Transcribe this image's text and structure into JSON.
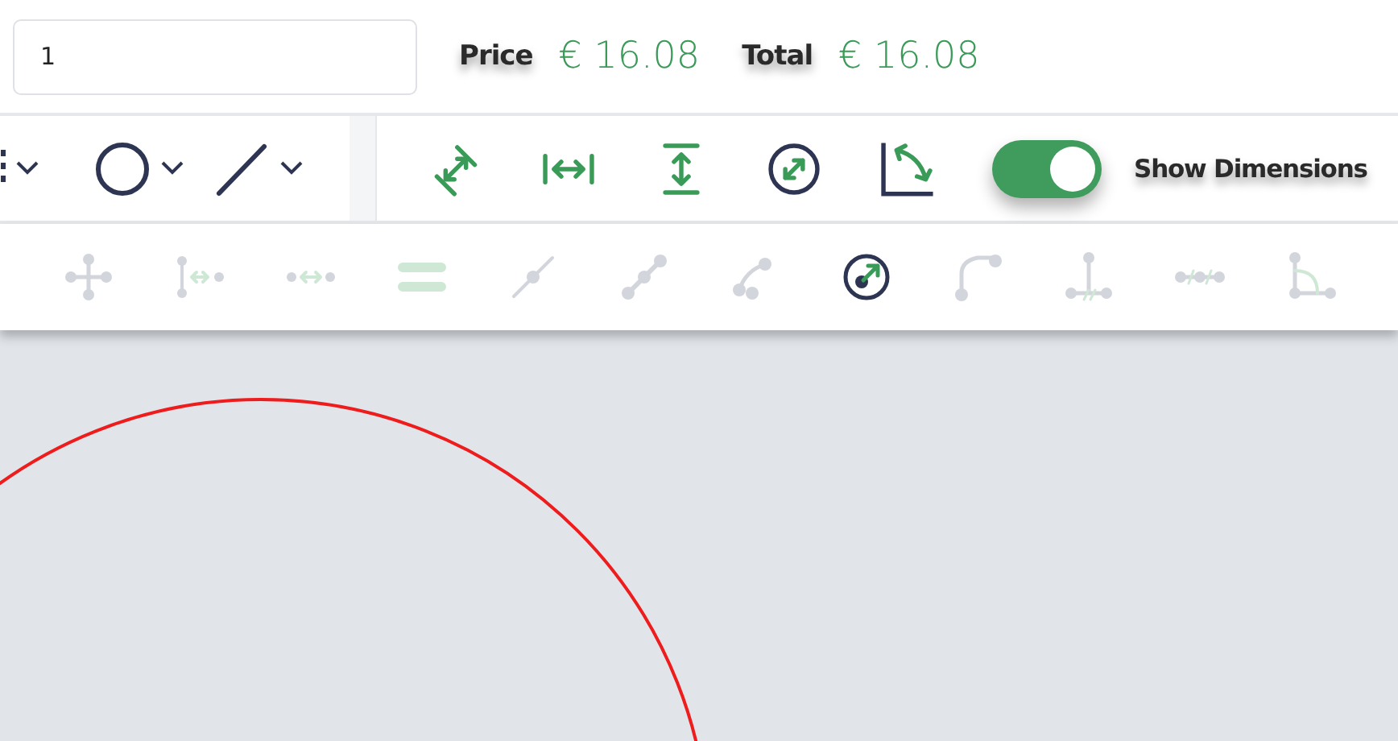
{
  "order_bar": {
    "quantity": {
      "value": "1"
    },
    "price": {
      "label": "Price",
      "value": "€ 16.08"
    },
    "total": {
      "label": "Total",
      "value": "€ 16.08"
    }
  },
  "shape_tools": [
    {
      "kind": "partial"
    },
    {
      "kind": "circle"
    },
    {
      "kind": "line"
    }
  ],
  "dimension_tools": [
    {
      "kind": "aligned"
    },
    {
      "kind": "horizontal"
    },
    {
      "kind": "vertical"
    },
    {
      "kind": "radius"
    },
    {
      "kind": "angle"
    }
  ],
  "dimensions_toggle": {
    "label": "Show Dimensions",
    "on": true
  },
  "constraint_tools": [
    {
      "kind": "coincident",
      "disabled": true
    },
    {
      "kind": "point-distance",
      "disabled": true
    },
    {
      "kind": "distance",
      "disabled": true
    },
    {
      "kind": "equal",
      "disabled": true
    },
    {
      "kind": "on-line",
      "disabled": true
    },
    {
      "kind": "collinear",
      "disabled": true
    },
    {
      "kind": "tangent",
      "disabled": true
    },
    {
      "kind": "radius",
      "disabled": false
    },
    {
      "kind": "arc",
      "disabled": true
    },
    {
      "kind": "perpendicular",
      "disabled": true
    },
    {
      "kind": "midpoint",
      "disabled": true
    },
    {
      "kind": "angle",
      "disabled": true
    }
  ]
}
